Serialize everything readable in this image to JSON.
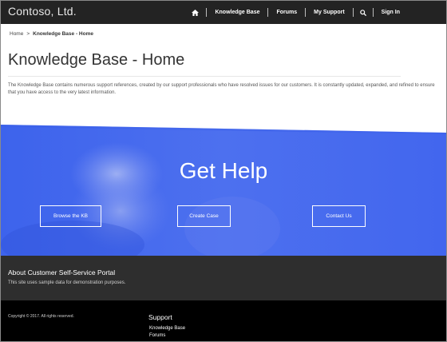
{
  "nav": {
    "brand": "Contoso, Ltd.",
    "home_icon": "home-icon",
    "items": [
      {
        "label": "Knowledge Base"
      },
      {
        "label": "Forums"
      },
      {
        "label": "My Support"
      }
    ],
    "search_icon": "search-icon",
    "sign_in": "Sign In"
  },
  "breadcrumb": {
    "home": "Home",
    "separator": ">",
    "current": "Knowledge Base - Home"
  },
  "page": {
    "title": "Knowledge Base - Home",
    "intro": "The Knowledge Base contains numerous support references, created by our support professionals who have resolved issues for our customers. It is constantly updated, expanded, and refined to ensure that you have access to the very latest information."
  },
  "hero": {
    "title": "Get Help",
    "buttons": [
      {
        "label": "Browse the KB"
      },
      {
        "label": "Create Case"
      },
      {
        "label": "Contact Us"
      }
    ],
    "accent": "#4a6ef0"
  },
  "about": {
    "title": "About Customer Self-Service Portal",
    "text": "This site uses sample data for demonstration purposes."
  },
  "footer": {
    "copyright": "Copyright © 2017. All rights reserved.",
    "heading": "Support",
    "links": [
      {
        "label": "Knowledge Base"
      },
      {
        "label": "Forums"
      }
    ]
  }
}
